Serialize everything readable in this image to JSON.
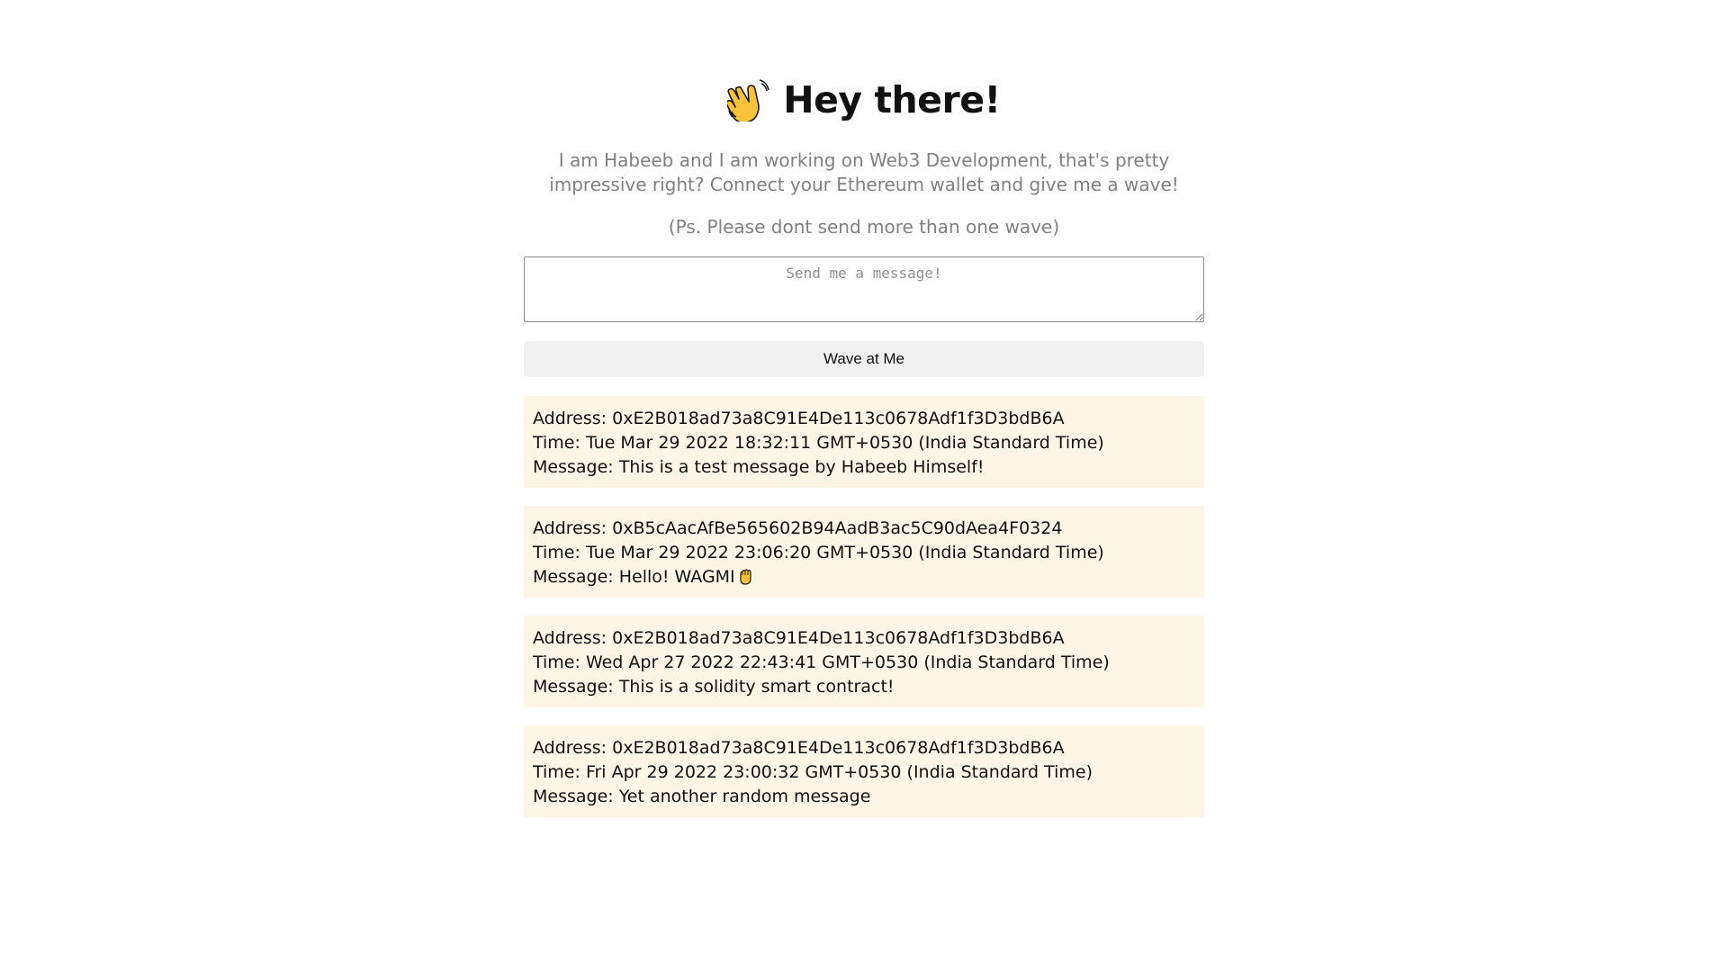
{
  "header": {
    "emoji_icon": "waving-hand-icon",
    "title": "Hey there!"
  },
  "bio": {
    "text": "I am Habeeb and I am working on Web3 Development, that's pretty impressive right? Connect your Ethereum wallet and give me a wave!",
    "note": "(Ps. Please dont send more than one wave)"
  },
  "form": {
    "message_placeholder": "Send me a message!",
    "message_value": "",
    "wave_button_label": "Wave at Me"
  },
  "waves": [
    {
      "address": "Address: 0xE2B018ad73a8C91E4De113c0678Adf1f3D3bdB6A",
      "time": "Time: Tue Mar 29 2022 18:32:11 GMT+0530 (India Standard Time)",
      "message": "Message: This is a test message by Habeeb Himself!"
    },
    {
      "address": "Address: 0xB5cAacAfBe565602B94AadB3ac5C90dAea4F0324",
      "time": "Time: Tue Mar 29 2022 23:06:20 GMT+0530 (India Standard Time)",
      "message": "Message: Hello! WAGMI",
      "message_icon": "raised-fist-icon"
    },
    {
      "address": "Address: 0xE2B018ad73a8C91E4De113c0678Adf1f3D3bdB6A",
      "time": "Time: Wed Apr 27 2022 22:43:41 GMT+0530 (India Standard Time)",
      "message": "Message: This is a solidity smart contract!"
    },
    {
      "address": "Address: 0xE2B018ad73a8C91E4De113c0678Adf1f3D3bdB6A",
      "time": "Time: Fri Apr 29 2022 23:00:32 GMT+0530 (India Standard Time)",
      "message": "Message: Yet another random message"
    }
  ],
  "colors": {
    "card_background": "#fdf5e6",
    "muted_text": "#808080",
    "button_background": "#f0f0f0"
  }
}
